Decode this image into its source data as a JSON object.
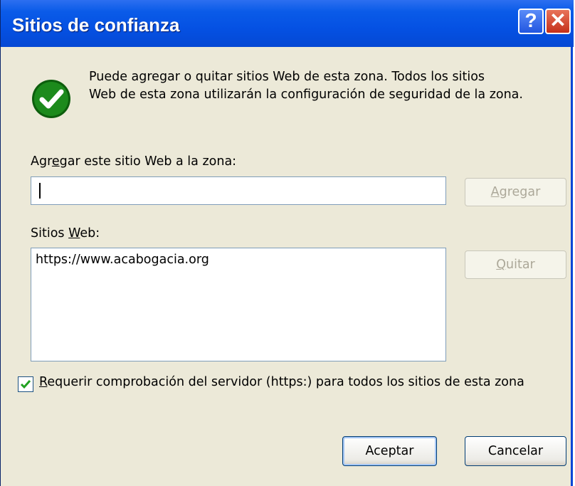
{
  "window": {
    "title": "Sitios de confianza",
    "help_glyph": "?",
    "close_glyph": "✕"
  },
  "description": {
    "line1": "Puede agregar o quitar sitios Web de esta zona.  Todos los sitios",
    "line2": "Web de esta zona utilizarán la configuración de seguridad de la zona."
  },
  "add_site": {
    "label_before": "Agr",
    "label_access": "e",
    "label_after": "gar este sitio Web a la zona:",
    "input_value": "",
    "button_access": "A",
    "button_rest": "gregar"
  },
  "sites": {
    "label_before": "Sitios ",
    "label_access": "W",
    "label_after": "eb:",
    "items": [
      "https://www.acabogacia.org"
    ],
    "remove_access": "Q",
    "remove_rest": "uitar"
  },
  "require_https": {
    "checked": true,
    "label_access": "R",
    "label_rest": "equerir comprobación del servidor (https:) para todos los sitios de esta zona"
  },
  "footer": {
    "ok_label": "Aceptar",
    "cancel_label": "Cancelar"
  },
  "colors": {
    "titlebar": "#0551e3",
    "dialog_bg": "#ece9d8",
    "check_icon": "#1c8a1c"
  },
  "icons": {
    "info": "green-check-icon",
    "checkbox_mark": "checkmark-icon"
  }
}
